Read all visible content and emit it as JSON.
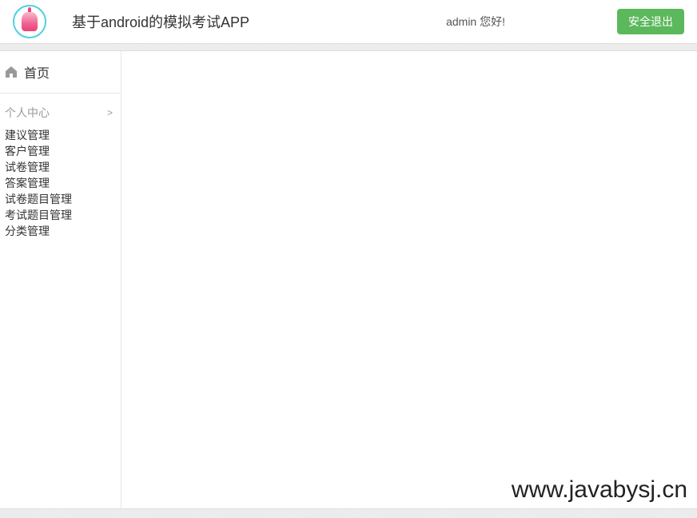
{
  "header": {
    "app_title": "基于android的模拟考试APP",
    "greeting": "admin 您好!",
    "logout_label": "安全退出"
  },
  "sidebar": {
    "home_label": "首页",
    "section_title": "个人中心",
    "section_arrow": ">",
    "menu_items": [
      "建议管理",
      "客户管理",
      "试卷管理",
      "答案管理",
      "试卷题目管理",
      "考试题目管理",
      "分类管理"
    ]
  },
  "watermark": "www.javabysj.cn"
}
